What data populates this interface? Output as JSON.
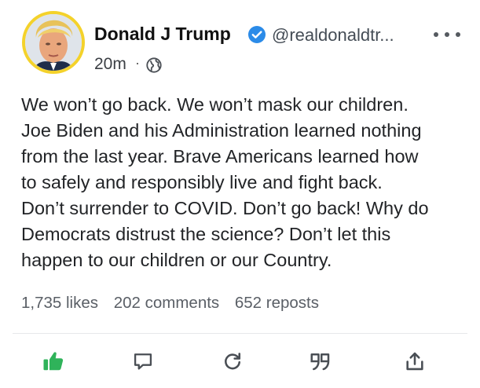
{
  "post": {
    "author_name": "Donald J Trump",
    "handle": "@realdonaldtr...",
    "time": "20m",
    "separator": "·",
    "visibility_icon": "globe-icon",
    "verified_icon": "verified-badge-icon",
    "lines": [
      "We won’t go back. We won’t mask our children.",
      "Joe Biden and his Administration learned nothing",
      "from the last year. Brave Americans learned how",
      "to safely and responsibly live and fight back.",
      "Don’t surrender to COVID. Don’t go back! Why do",
      "Democrats distrust the science? Don’t let this",
      "happen to our children or our Country."
    ],
    "stats": {
      "likes": "1,735 likes",
      "comments": "202 comments",
      "reposts": "652 reposts"
    }
  },
  "actions": [
    {
      "name": "like",
      "icon": "thumbs-up-icon",
      "active": true
    },
    {
      "name": "comment",
      "icon": "comment-icon"
    },
    {
      "name": "repost",
      "icon": "repost-icon"
    },
    {
      "name": "quote",
      "icon": "quote-icon"
    },
    {
      "name": "share",
      "icon": "share-icon"
    }
  ],
  "colors": {
    "avatar_ring": "#f4d22b",
    "verified": "#2b8be8",
    "like_active": "#2fb35a",
    "icon": "#4a4f55"
  }
}
